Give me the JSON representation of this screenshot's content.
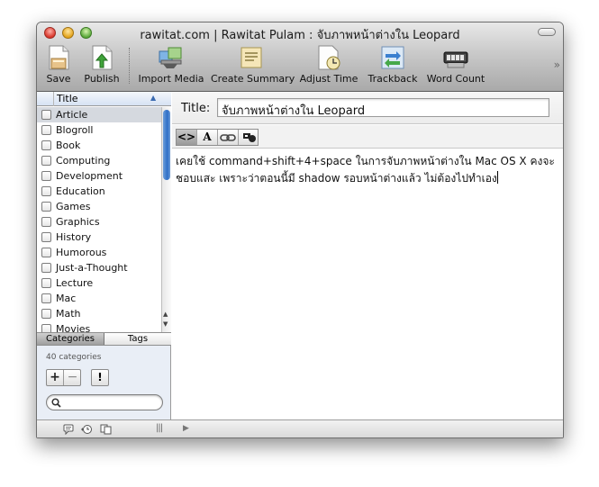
{
  "window": {
    "title": "rawitat.com | Rawitat Pulam : จับภาพหน้าต่างใน Leopard"
  },
  "toolbar": {
    "buttons": [
      {
        "label": "Save",
        "icon": "save-icon"
      },
      {
        "label": "Publish",
        "icon": "publish-icon"
      },
      {
        "label": "Import Media",
        "icon": "import-media-icon"
      },
      {
        "label": "Create Summary",
        "icon": "create-summary-icon"
      },
      {
        "label": "Adjust Time",
        "icon": "adjust-time-icon"
      },
      {
        "label": "Trackback",
        "icon": "trackback-icon"
      },
      {
        "label": "Word Count",
        "icon": "word-count-icon"
      }
    ],
    "overflow": "»"
  },
  "categories": {
    "column_title": "Title",
    "items": [
      {
        "label": "Article",
        "selected": true
      },
      {
        "label": "Blogroll"
      },
      {
        "label": "Book"
      },
      {
        "label": "Computing"
      },
      {
        "label": "Development"
      },
      {
        "label": "Education"
      },
      {
        "label": "Games"
      },
      {
        "label": "Graphics"
      },
      {
        "label": "History"
      },
      {
        "label": "Humorous"
      },
      {
        "label": "Just-a-Thought"
      },
      {
        "label": "Lecture"
      },
      {
        "label": "Mac"
      },
      {
        "label": "Math"
      },
      {
        "label": "Movies"
      }
    ],
    "tabs": [
      "Categories",
      "Tags"
    ],
    "count_text": "40 categories",
    "add_label": "+",
    "remove_label": "−",
    "action_label": "!",
    "search_placeholder": ""
  },
  "post": {
    "title_label": "Title:",
    "title_value": "จับภาพหน้าต่างใน Leopard",
    "body": "เคยใช้ command+shift+4+space ในการจับภาพหน้าต่างใน Mac OS X คงจะชอบแสะ เพราะว่าตอนนี้มี shadow รอบหน้าต่างแล้ว ไม่ต้องไปทำเอง",
    "format_buttons": {
      "html": "<>",
      "rich": "A"
    }
  },
  "colors": {
    "selection_blue": "#2f6fc7",
    "sidebar_bg": "#e9eef6"
  }
}
